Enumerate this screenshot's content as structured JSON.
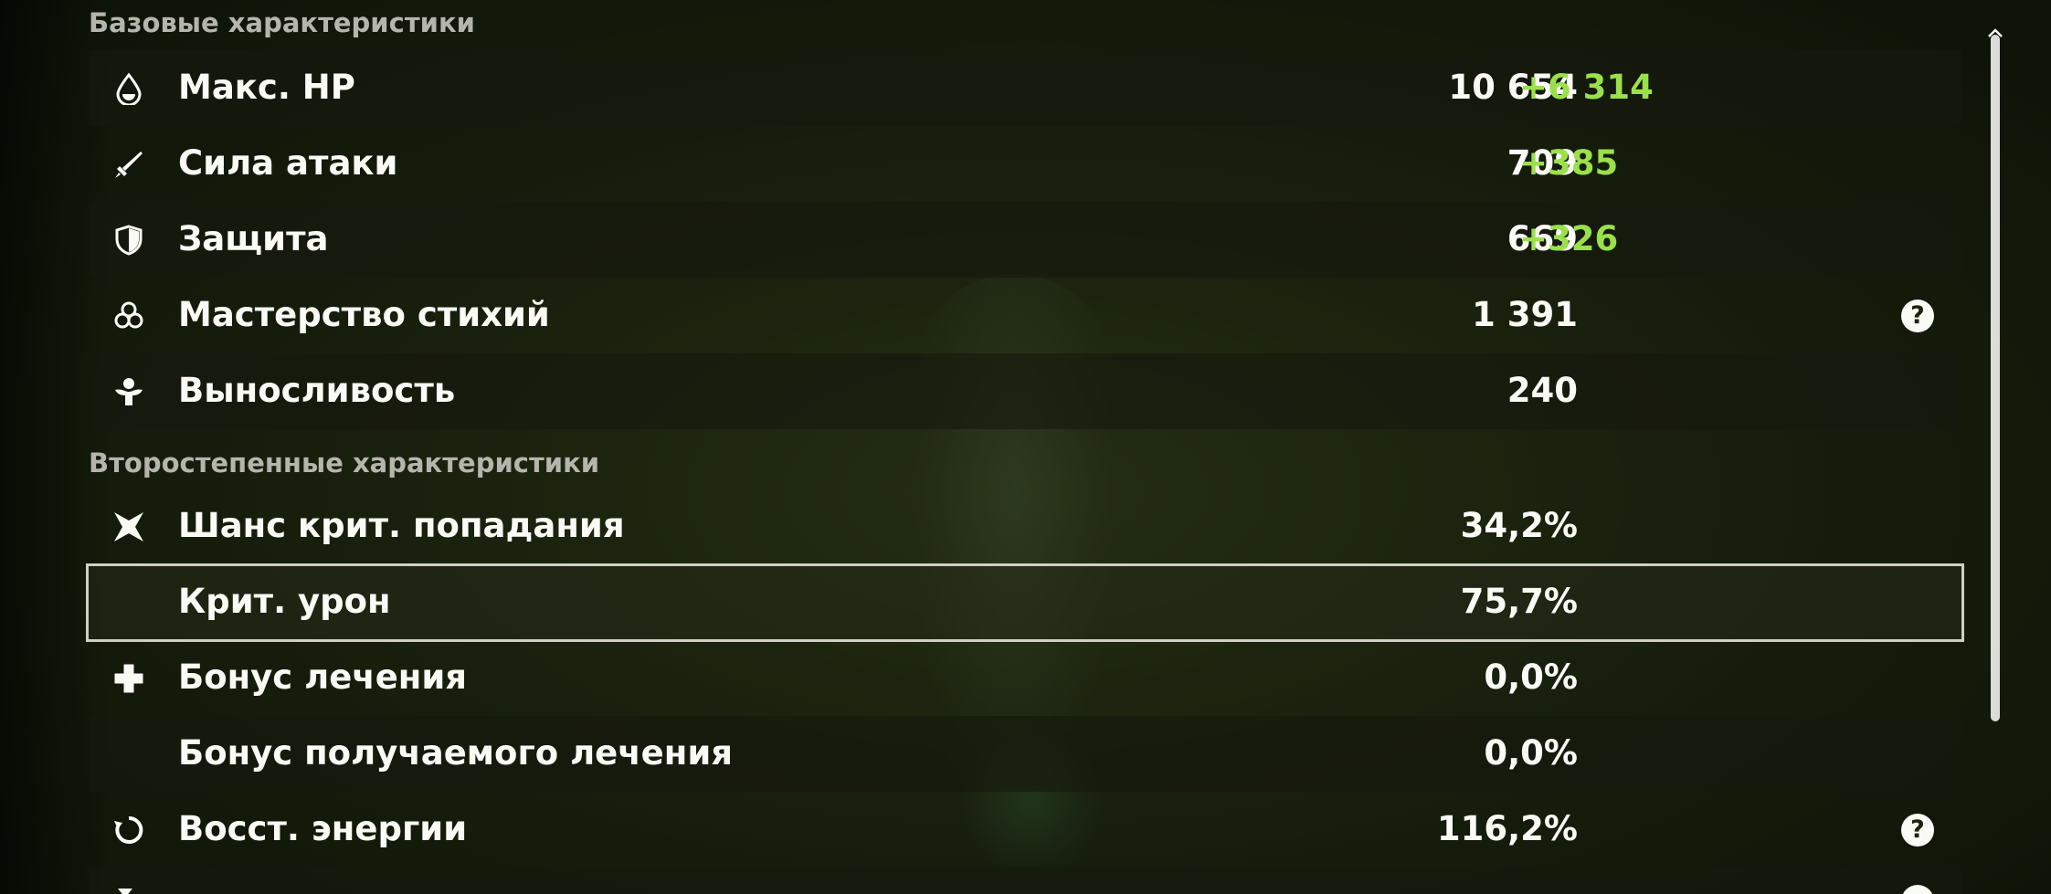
{
  "sections": {
    "base_title": "Базовые характеристики",
    "secondary_title": "Второстепенные характеристики"
  },
  "base_stats": [
    {
      "label": "Макс. HP",
      "value": "10 654",
      "bonus": "+6 314",
      "icon": "hp-drop-icon"
    },
    {
      "label": "Сила атаки",
      "value": "709",
      "bonus": "+385",
      "icon": "sword-icon"
    },
    {
      "label": "Защита",
      "value": "669",
      "bonus": "+326",
      "icon": "shield-icon"
    },
    {
      "label": "Мастерство стихий",
      "value": "1 391",
      "bonus": "",
      "icon": "elemental-mastery-icon",
      "help": "?"
    },
    {
      "label": "Выносливость",
      "value": "240",
      "bonus": "",
      "icon": "stamina-icon"
    }
  ],
  "secondary_stats": [
    {
      "label": "Шанс крит. попадания",
      "value": "34,2%",
      "icon": "crit-rate-icon"
    },
    {
      "label": "Крит. урон",
      "value": "75,7%",
      "icon": "",
      "selected": true
    },
    {
      "label": "Бонус лечения",
      "value": "0,0%",
      "icon": "healing-cross-icon"
    },
    {
      "label": "Бонус получаемого лечения",
      "value": "0,0%",
      "icon": ""
    },
    {
      "label": "Восст. энергии",
      "value": "116,2%",
      "icon": "energy-recharge-icon",
      "help": "?"
    },
    {
      "label": "",
      "value": "",
      "icon": "partial-row-icon",
      "help": ""
    }
  ],
  "colors": {
    "bonus_green": "#9ae04b",
    "text_white": "#fbfbf6",
    "section_gray": "#b5b5ad"
  }
}
